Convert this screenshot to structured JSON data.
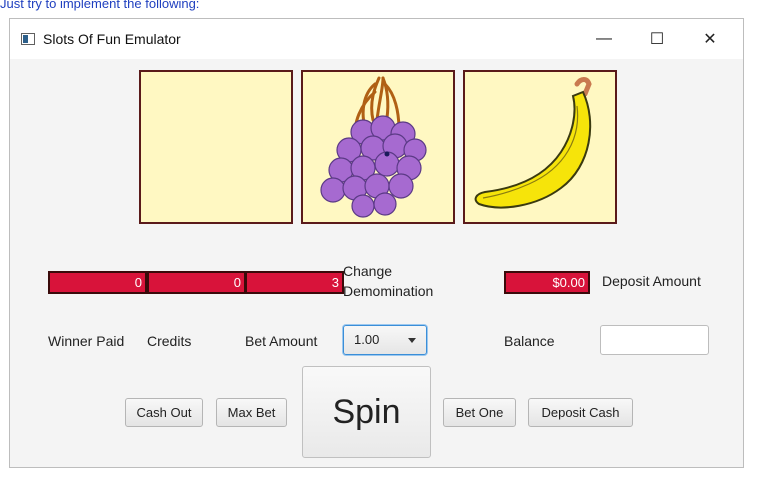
{
  "note": "Just try to implement the following:",
  "window": {
    "title": "Slots Of Fun Emulator",
    "minimize_glyph": "—",
    "maximize_glyph": "☐",
    "close_glyph": "✕"
  },
  "reels": [
    {
      "symbol": "blank"
    },
    {
      "symbol": "grapes-icon"
    },
    {
      "symbol": "banana-icon"
    }
  ],
  "counters": {
    "winner_paid": "0",
    "credits": "0",
    "bet_amount": "3",
    "balance": "$0.00"
  },
  "labels": {
    "winner_paid": "Winner Paid",
    "credits": "Credits",
    "bet_amount": "Bet Amount",
    "change_denomination_line1": "Change",
    "change_denomination_line2": "Demomination",
    "deposit_amount": "Deposit Amount",
    "balance": "Balance"
  },
  "denomination": {
    "selected": "1.00"
  },
  "deposit_input": {
    "value": ""
  },
  "buttons": {
    "cash_out": "Cash Out",
    "max_bet": "Max Bet",
    "spin": "Spin",
    "bet_one": "Bet One",
    "deposit_cash": "Deposit Cash"
  },
  "colors": {
    "counter_bg": "#d8133a",
    "reel_bg": "#fff8c2",
    "reel_border": "#5a1a1a",
    "grape": "#a66ad0",
    "banana": "#f6e40a"
  }
}
